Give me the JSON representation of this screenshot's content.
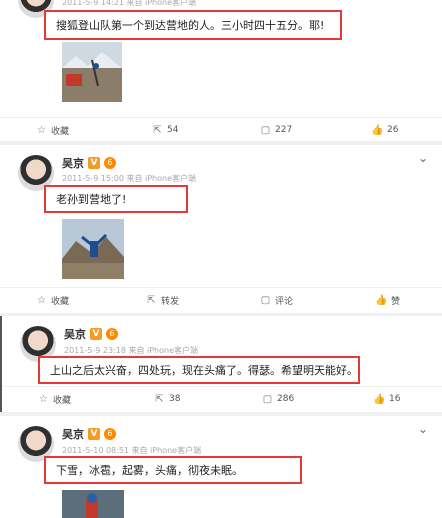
{
  "post1": {
    "meta": "2011-5-9 14:21 来自 iPhone客户端",
    "text": "搜狐登山队第一个到达营地的人。三小时四十五分。耶!",
    "actions": {
      "fav": "收藏",
      "repost": "54",
      "comment": "227",
      "like": "26"
    }
  },
  "post2": {
    "name": "吴京",
    "badge_v": "V",
    "badge_lvl": "6",
    "meta": "2011-5-9 15:00 来自 iPhone客户端",
    "text": "老孙到营地了!",
    "actions": {
      "fav": "收藏",
      "repost": "转发",
      "comment": "评论",
      "like": "赞"
    }
  },
  "post3": {
    "name": "吴京",
    "badge_v": "V",
    "badge_lvl": "6",
    "meta": "2011-5-9 23:18 来自 iPhone客户端",
    "text": "上山之后太兴奋，四处玩，现在头痛了。得瑟。希望明天能好。",
    "actions": {
      "fav": "收藏",
      "repost": "38",
      "comment": "286",
      "like": "16"
    }
  },
  "post4": {
    "name": "吴京",
    "badge_v": "V",
    "badge_lvl": "6",
    "meta": "2011-5-10 08:51 来自 iPhone客户端",
    "text": "下雪，冰雹，起雾，头痛，彻夜未眠。"
  },
  "icons": {
    "star": "star-icon",
    "share": "share-icon",
    "comment": "comment-icon",
    "like": "thumbs-up-icon",
    "chevron": "chevron-down-icon"
  },
  "colors": {
    "highlight": "#e53935",
    "vbadge": "#f59a23",
    "meta": "#aaaaaa"
  }
}
